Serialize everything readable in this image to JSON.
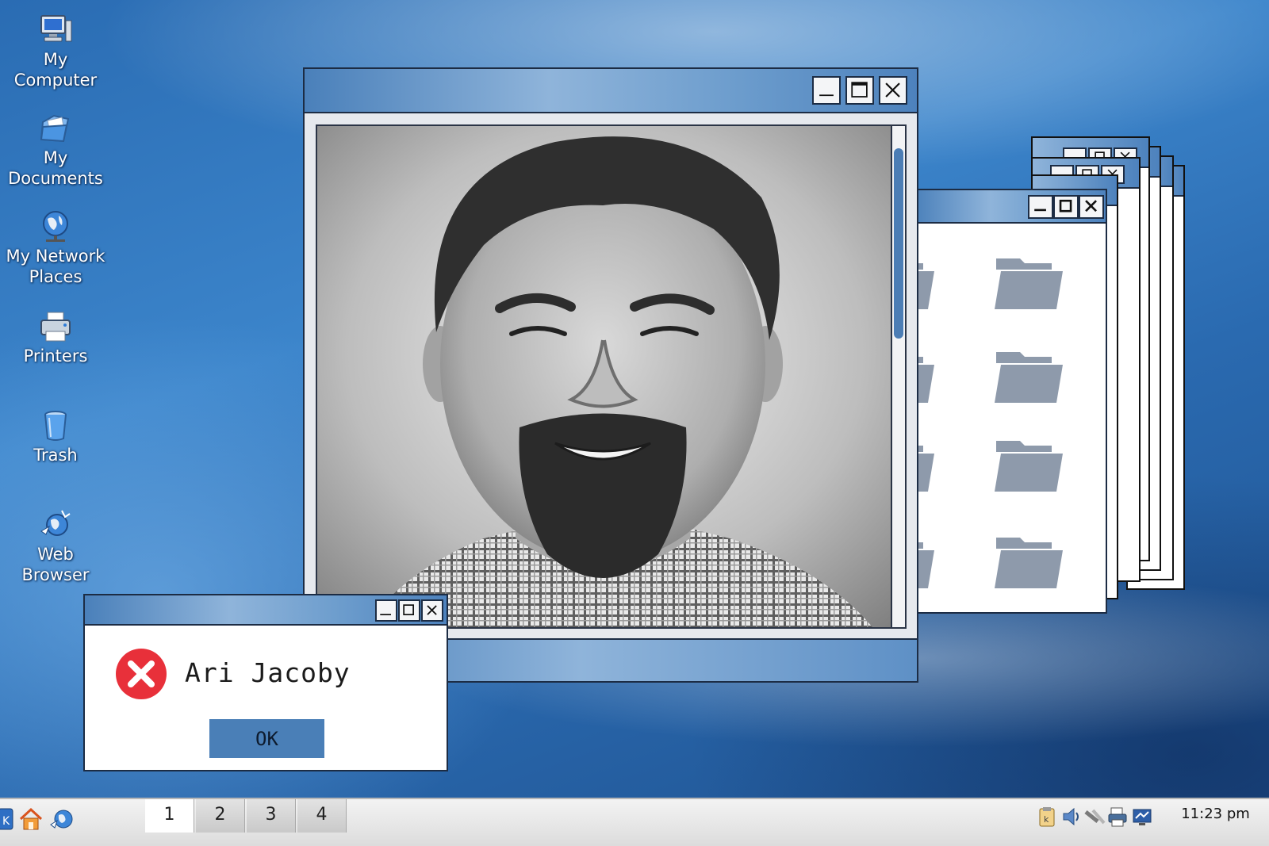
{
  "desktop": {
    "icons": [
      {
        "label_line1": "My",
        "label_line2": "Computer",
        "icon": "computer-icon"
      },
      {
        "label_line1": "My",
        "label_line2": "Documents",
        "icon": "documents-folder-icon"
      },
      {
        "label_line1": "My Network",
        "label_line2": "Places",
        "icon": "network-globe-icon"
      },
      {
        "label_line1": "Printers",
        "label_line2": "",
        "icon": "printer-icon"
      },
      {
        "label_line1": "Trash",
        "label_line2": "",
        "icon": "trash-icon"
      },
      {
        "label_line1": "Web",
        "label_line2": "Browser",
        "icon": "web-browser-icon"
      }
    ]
  },
  "photo_window": {
    "controls": [
      "minimize-icon",
      "maximize-icon",
      "close-icon"
    ],
    "image": "portrait-photo"
  },
  "dialog": {
    "message": "Ari Jacoby",
    "ok_label": "OK",
    "icon": "error-icon",
    "accent": "#e8303a"
  },
  "taskbar": {
    "workspaces": [
      "1",
      "2",
      "3",
      "4"
    ],
    "active_workspace": "1",
    "clock": "11:23 pm",
    "launchers": [
      "menu-icon",
      "home-icon",
      "browser-icon"
    ],
    "tray": [
      "clipboard-icon",
      "volume-icon",
      "network-icon",
      "printer-tray-icon",
      "display-icon"
    ]
  },
  "colors": {
    "titlebar": "#6d9dcd",
    "button_blue": "#4a7fb7",
    "folder_gray": "#8e9aab"
  }
}
